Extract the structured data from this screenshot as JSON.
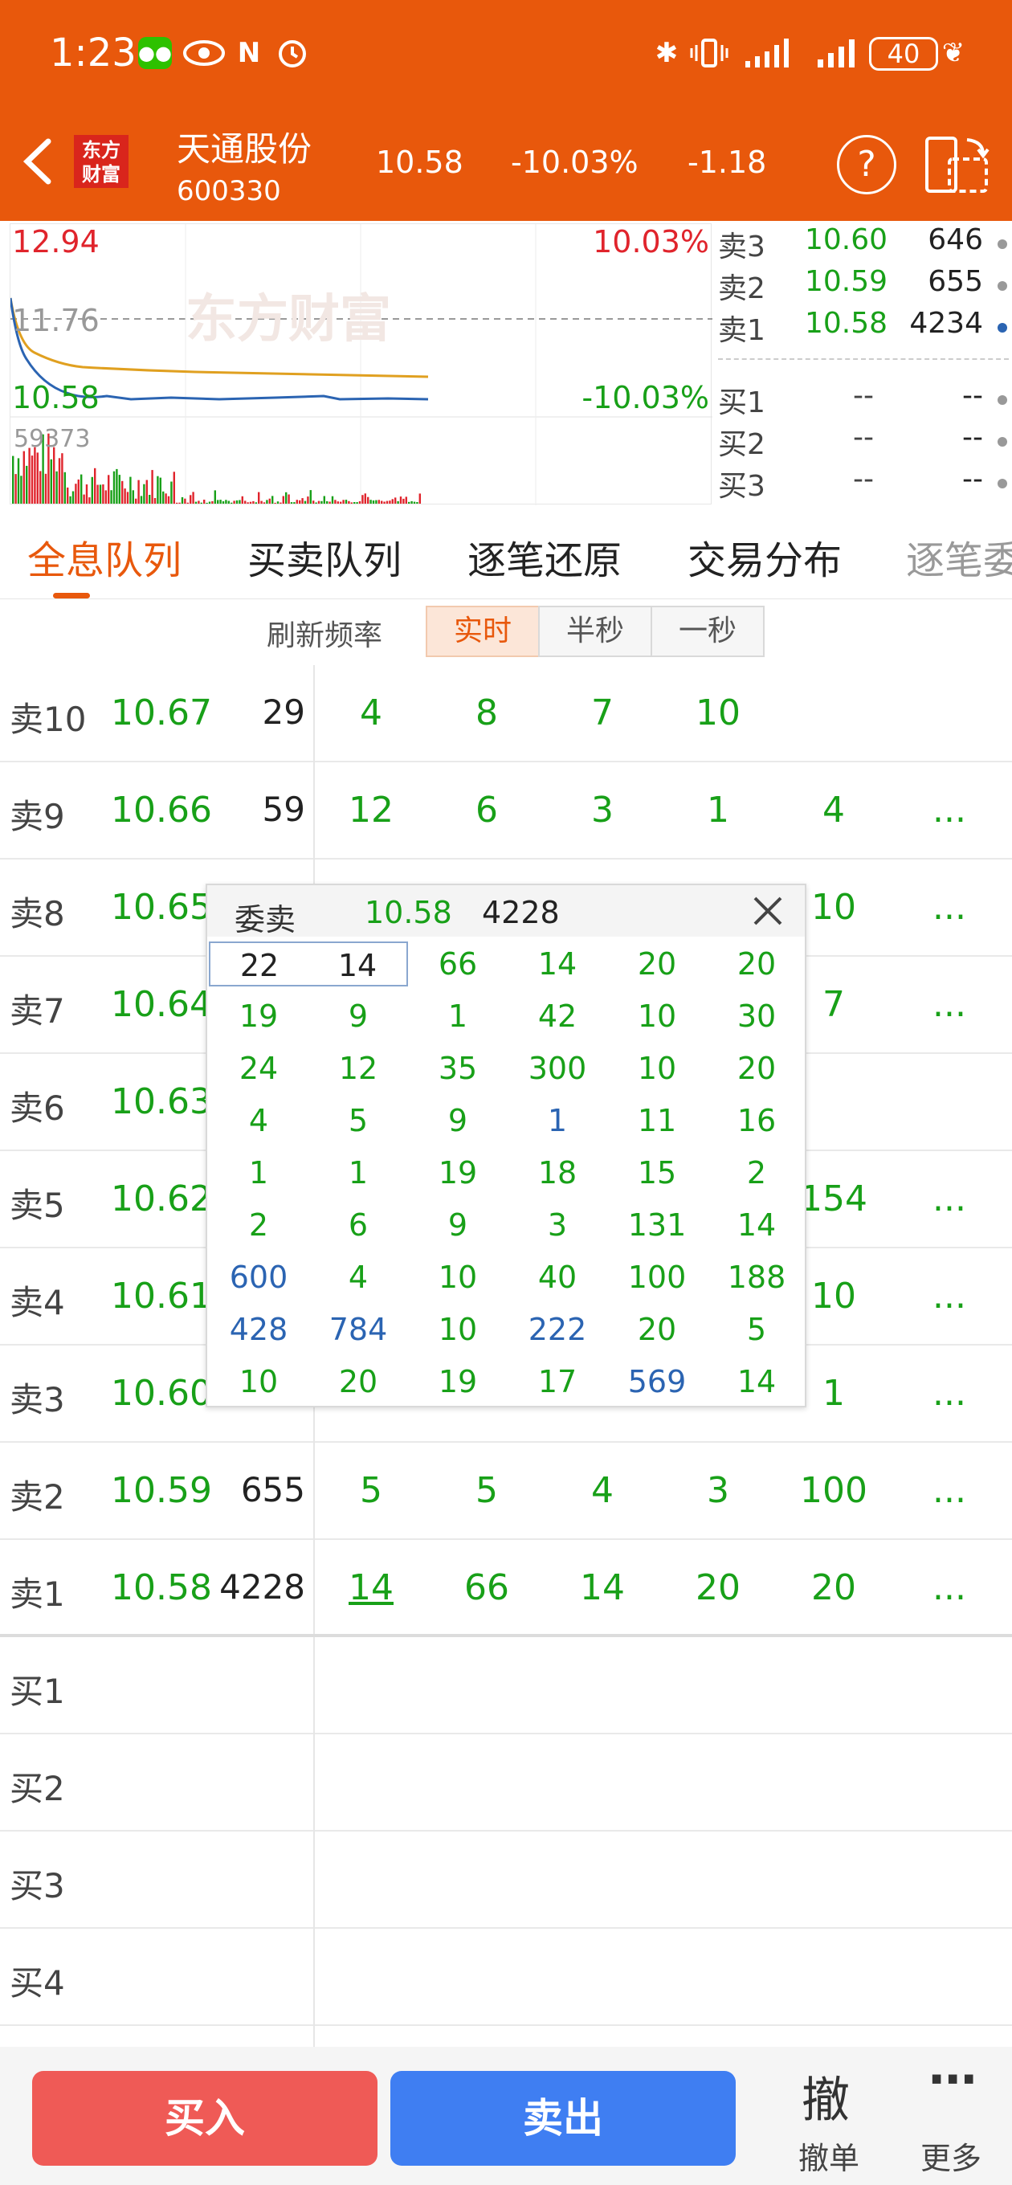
{
  "status_bar": {
    "time": "1:23",
    "battery": "40"
  },
  "header": {
    "logo_line1": "东方",
    "logo_line2": "财富",
    "stock_name": "天通股份",
    "stock_code": "600330",
    "price": "10.58",
    "change_pct": "-10.03%",
    "change": "-1.18",
    "help": "?"
  },
  "chart": {
    "price_high": "12.94",
    "pct_high": "10.03%",
    "ref_price": "11.76",
    "price_low": "10.58",
    "pct_low": "-10.03%",
    "volume_max": "59373",
    "watermark": "东方财富",
    "colors": {
      "up": "#e0242c",
      "down": "#18a018",
      "price_line": "#2b64b2",
      "avg_line": "#e0a020"
    }
  },
  "orderbook": {
    "asks": [
      {
        "label": "卖3",
        "price": "10.60",
        "vol": "646"
      },
      {
        "label": "卖2",
        "price": "10.59",
        "vol": "655"
      },
      {
        "label": "卖1",
        "price": "10.58",
        "vol": "4234"
      }
    ],
    "bids": [
      {
        "label": "买1",
        "price": "--",
        "vol": "--"
      },
      {
        "label": "买2",
        "price": "--",
        "vol": "--"
      },
      {
        "label": "买3",
        "price": "--",
        "vol": "--"
      }
    ]
  },
  "tabs": [
    "全息队列",
    "买卖队列",
    "逐笔还原",
    "交易分布",
    "逐笔委"
  ],
  "refresh": {
    "label": "刷新频率",
    "options": [
      "实时",
      "半秒",
      "一秒"
    ]
  },
  "queue": [
    {
      "label": "卖10",
      "price": "10.67",
      "vol": "29",
      "cells": [
        "4",
        "8",
        "7",
        "10",
        "",
        ""
      ]
    },
    {
      "label": "卖9",
      "price": "10.66",
      "vol": "59",
      "cells": [
        "12",
        "6",
        "3",
        "1",
        "4",
        "..."
      ]
    },
    {
      "label": "卖8",
      "price": "10.65",
      "vol": "",
      "cells": [
        "",
        "",
        "",
        "",
        "10",
        "..."
      ]
    },
    {
      "label": "卖7",
      "price": "10.64",
      "vol": "",
      "cells": [
        "",
        "",
        "",
        "",
        "7",
        "..."
      ]
    },
    {
      "label": "卖6",
      "price": "10.63",
      "vol": "",
      "cells": [
        "",
        "",
        "",
        "",
        "",
        ""
      ]
    },
    {
      "label": "卖5",
      "price": "10.62",
      "vol": "",
      "cells": [
        "",
        "",
        "",
        "",
        "154",
        "..."
      ]
    },
    {
      "label": "卖4",
      "price": "10.61",
      "vol": "",
      "cells": [
        "",
        "",
        "",
        "",
        "10",
        "..."
      ]
    },
    {
      "label": "卖3",
      "price": "10.60",
      "vol": "",
      "cells": [
        "",
        "",
        "",
        "",
        "1",
        "..."
      ]
    },
    {
      "label": "卖2",
      "price": "10.59",
      "vol": "655",
      "cells": [
        "5",
        "5",
        "4",
        "3",
        "100",
        "..."
      ]
    },
    {
      "label": "卖1",
      "price": "10.58",
      "vol": "4228",
      "cells": [
        "14",
        "66",
        "14",
        "20",
        "20",
        "..."
      ]
    },
    {
      "label": "买1",
      "price": "",
      "vol": "",
      "cells": [
        "",
        "",
        "",
        "",
        "",
        ""
      ]
    },
    {
      "label": "买2",
      "price": "",
      "vol": "",
      "cells": [
        "",
        "",
        "",
        "",
        "",
        ""
      ]
    },
    {
      "label": "买3",
      "price": "",
      "vol": "",
      "cells": [
        "",
        "",
        "",
        "",
        "",
        ""
      ]
    },
    {
      "label": "买4",
      "price": "",
      "vol": "",
      "cells": [
        "",
        "",
        "",
        "",
        "",
        ""
      ]
    }
  ],
  "popup": {
    "title": "委卖",
    "price": "10.58",
    "volume": "4228",
    "grid": [
      [
        "22",
        "14",
        "66",
        "14",
        "20",
        "20"
      ],
      [
        "19",
        "9",
        "1",
        "42",
        "10",
        "30"
      ],
      [
        "24",
        "12",
        "35",
        "300",
        "10",
        "20"
      ],
      [
        "4",
        "5",
        "9",
        "1",
        "11",
        "16"
      ],
      [
        "1",
        "1",
        "19",
        "18",
        "15",
        "2"
      ],
      [
        "2",
        "6",
        "9",
        "3",
        "131",
        "14"
      ],
      [
        "600",
        "4",
        "10",
        "40",
        "100",
        "188"
      ],
      [
        "428",
        "784",
        "10",
        "222",
        "20",
        "5"
      ],
      [
        "10",
        "20",
        "19",
        "17",
        "569",
        "14"
      ]
    ],
    "large_order_color": "#2b64b2"
  },
  "bottom": {
    "buy": "买入",
    "sell": "卖出",
    "cancel_icon": "撤",
    "cancel": "撤单",
    "more": "更多"
  }
}
